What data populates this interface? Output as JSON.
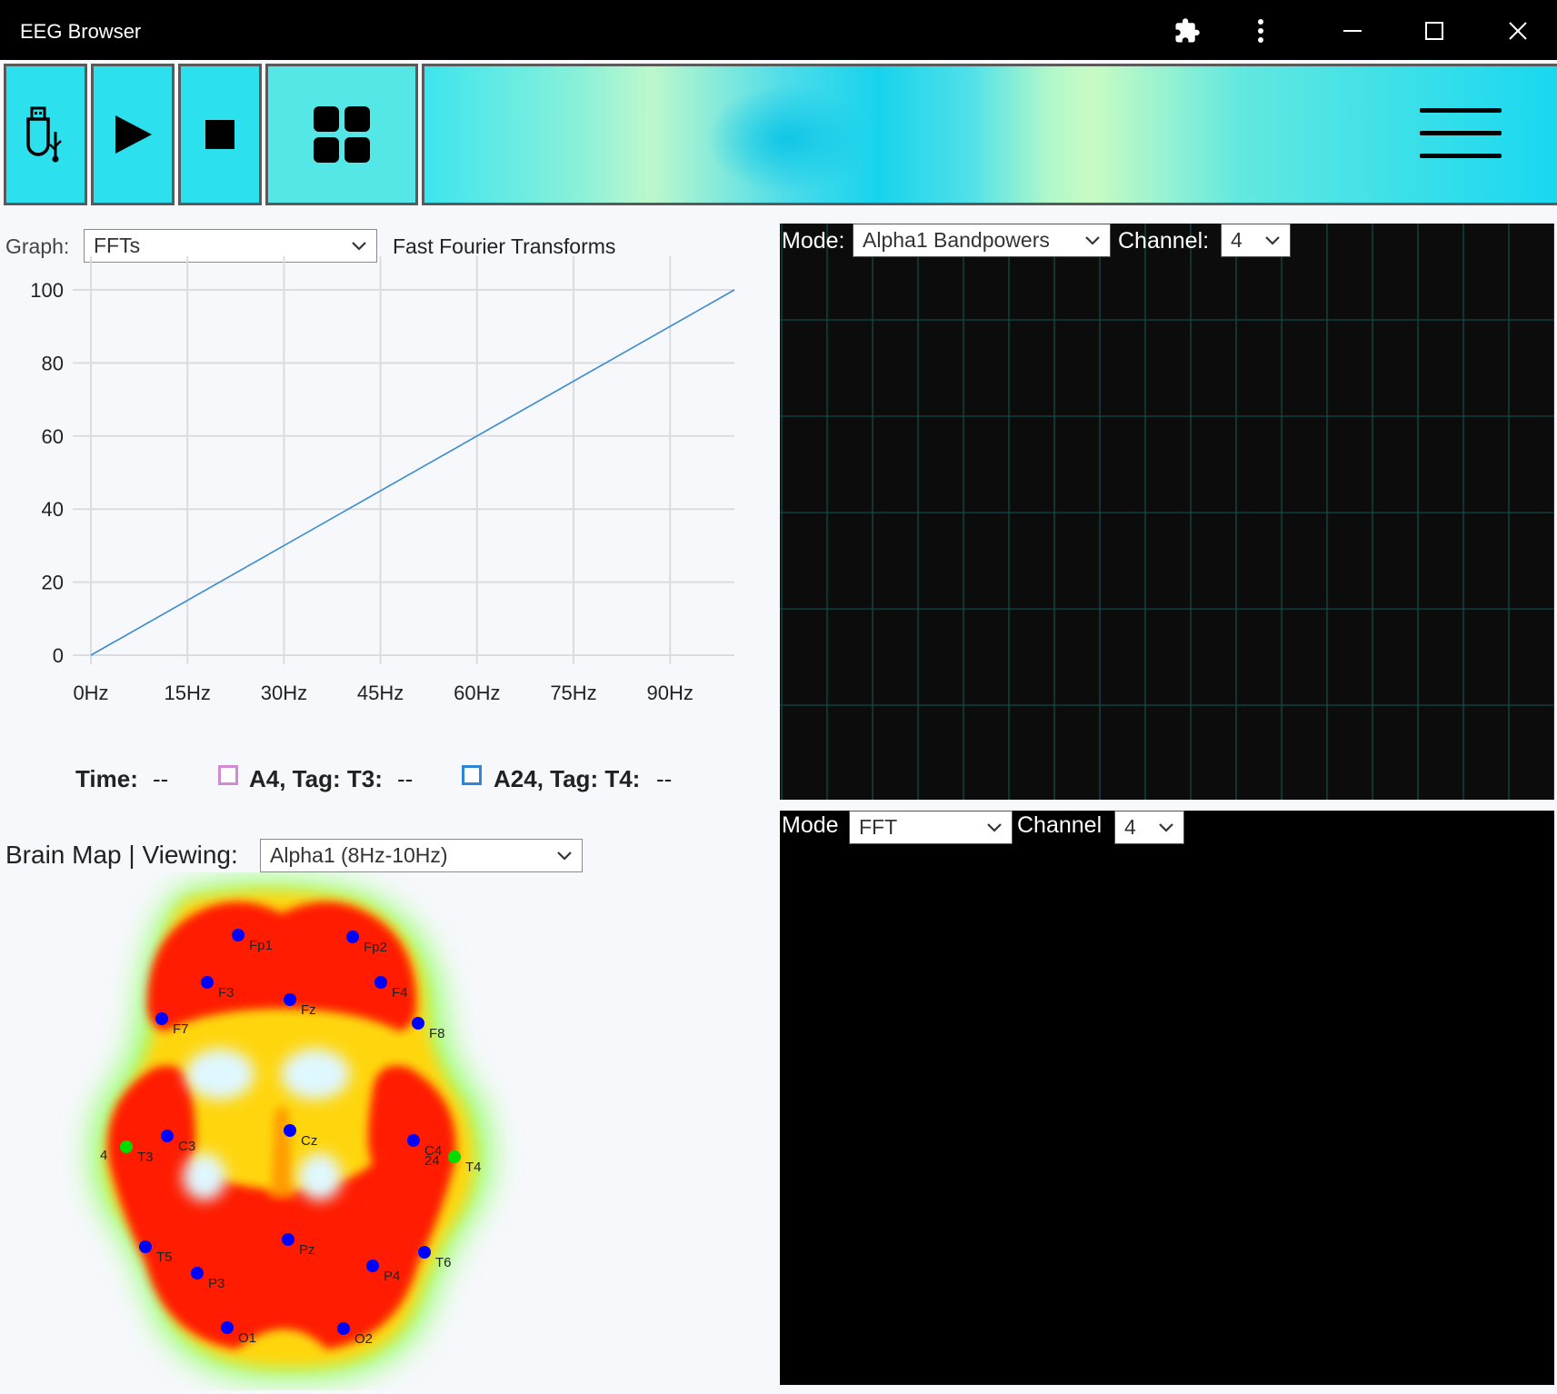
{
  "window": {
    "title": "EEG Browser",
    "icons": [
      "puzzle-icon",
      "more-vert-icon",
      "minimize-icon",
      "maximize-icon",
      "close-icon"
    ]
  },
  "toolbar": {
    "buttons": [
      "usb-icon",
      "play-icon",
      "stop-icon",
      "grid-icon"
    ],
    "menu_icon": "hamburger-icon",
    "colors": {
      "button": "#2ce0ee",
      "border": "#5a5a5a"
    }
  },
  "graph": {
    "label": "Graph:",
    "selected": "FFTs",
    "title": "Fast Fourier Transforms"
  },
  "chart_data": {
    "type": "line",
    "title": "Fast Fourier Transforms",
    "x_tick_labels": [
      "0Hz",
      "15Hz",
      "30Hz",
      "45Hz",
      "60Hz",
      "75Hz",
      "90Hz"
    ],
    "x_ticks": [
      0,
      15,
      30,
      45,
      60,
      75,
      90
    ],
    "y_ticks": [
      0,
      20,
      40,
      60,
      80,
      100
    ],
    "xlim": [
      0,
      100
    ],
    "ylim": [
      0,
      100
    ],
    "grid": true,
    "series": [
      {
        "x": [
          0,
          100
        ],
        "y": [
          0,
          100
        ],
        "color": "#3a8bd0"
      }
    ]
  },
  "legend": {
    "time_label": "Time:",
    "time_value": "--",
    "items": [
      {
        "label": "A4, Tag: T3:",
        "value": "--",
        "color": "#d28ad6"
      },
      {
        "label": "A24, Tag: T4:",
        "value": "--",
        "color": "#2f86d8"
      }
    ]
  },
  "brainmap": {
    "title": "Brain Map | Viewing:",
    "selected": "Alpha1 (8Hz-10Hz)",
    "channel_labels": {
      "T3": "4",
      "T4": "24"
    },
    "electrodes": [
      "Fp1",
      "Fp2",
      "F3",
      "F4",
      "F7",
      "Fz",
      "F8",
      "T3",
      "C3",
      "Cz",
      "C4",
      "T4",
      "T5",
      "P3",
      "Pz",
      "P4",
      "T6",
      "O1",
      "O2"
    ],
    "electrode_label_for_pz": "Pz",
    "colors": {
      "electrode": "#0000ff",
      "active_electrode": "#00dd00",
      "heat": "#ff0000"
    }
  },
  "panel_top": {
    "mode_label": "Mode:",
    "mode_selected": "Alpha1 Bandpowers",
    "channel_label": "Channel:",
    "channel_selected": "4",
    "grid_color": "#0f4a4a"
  },
  "panel_bottom": {
    "mode_label": "Mode",
    "mode_selected": "FFT",
    "channel_label": "Channel",
    "channel_selected": "4"
  }
}
